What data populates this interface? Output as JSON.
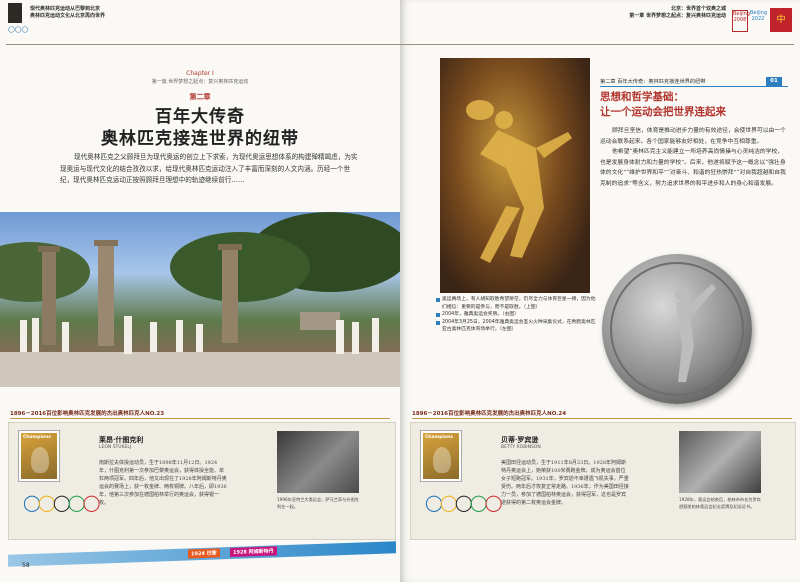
{
  "header": {
    "left_line1": "现代奥林匹克运动从巴黎到北京",
    "left_line2": "奥林匹克运动文化从北京再向世界",
    "right_line1": "北京：世界首个双奥之城",
    "right_line2": "第一章 世界梦想之起点：复兴奥林匹克运动",
    "emblem1": "Beijing 2008",
    "emblem2": "Beijing 2022",
    "emblem3": "中"
  },
  "left_page": {
    "chapter_en": "Chapter I",
    "chapter_sub": "第一篇 世界梦想之起点：复兴奥林匹克运动",
    "chapter_no": "第二章",
    "title_line1": "百年大传奇",
    "title_line2": "奥林匹克接连世界的纽带",
    "intro": "现代奥林匹克之父顾拜旦为现代奥运的创立上下求索，为现代奥运思想体系的构建殚精竭虑，为实现奥运与现代文化的结合孜孜以求，给现代奥林匹克运动注入了丰富而深刻的人文内涵。历经一个世纪，现代奥林匹克运动正按照顾拜旦理想中的轨迹继续前行……",
    "strip": "1896－2016百位影响奥林匹克发展的杰出奥林匹克人NO.23",
    "athlete_name": "莱昂·什图克利",
    "athlete_en": "LEON ŠTUKELJ",
    "athlete_bio": "南斯拉夫体操运动员，生于1898年11月12日。1924年，什图克利第一次参加巴黎奥运会，获得体操全能、单杠两项冠军。四年后，他又出现在了1928年阿姆斯特丹奥运会的赛场上，获一枚金牌、两枚铜牌。八年后，即1936年，他第三次参加在德国柏林举行的奥运会，获得银一枚。",
    "stamp_label": "Champions",
    "photo_caption": "1996年亚特兰大奥运会，萨马兰奇与什图克利在一起。",
    "timeline_mark1": "1924 巴黎",
    "timeline_mark2": "1928 阿姆斯特丹",
    "page_number": "58"
  },
  "right_page": {
    "section_tag": "第二章 百年大传奇：奥林匹克接连世界的纽带",
    "section_num": "01",
    "section_title1": "思想和哲学基础：",
    "section_title2": "让一个运动会把世界连起来",
    "body_p1": "顾拜旦坚信，体育是推动进步力量的有效途径，会使世界可以由一个运动会联系起来。各个国家能够友好相处，在竞争中互相尊重。",
    "body_p2": "他希望“奥林匹克主义能建立一所培养高尚情操与心灵纯洁的学校，也是发展身体耐力和力量的学校”。后来，他遂将赋予这一概念以“强壮身体的文化”“维护世界和平”“对奋斗、和谐的狂热崇拜”“对自我超越和自我克制的追求”等含义，努力追求世界的和平进步和人的身心和谐发展。",
    "cap1": "奥运赛场上，有人胡知取胜希望渺茫，仍尽全力与体育巨星一搏，因为他们相信：重要的是参与，而不是取胜。（上图）",
    "cap2": "2004年，雅典奥运会奖牌。（右图）",
    "cap3": "2004年3月25日，2004年雅典奥运会圣火火种采集仪式，在希腊奥林匹亚古奥林匹克体育场举行。（左图）",
    "strip": "1896－2016百位影响奥林匹克发展的杰出奥林匹克人NO.24",
    "athlete_name": "贝蒂·罗宾逊",
    "athlete_en": "BETTY ROBINSON",
    "athlete_bio": "美国田径运动员，生于1911年8月23日。1928年阿姆斯特丹奥运会上，她荣获100米赛跑金牌，成为奥运会首位女子短跑冠军。1931年，罗宾逊不幸遭遇飞机失事，严重受伤。两年后才恢复正常走路。1936年，作为美国田径接力一员，参加了德国柏林奥运会，获得冠军，这也是罗宾逊获得的第二枚奥运会金牌。",
    "stamp_label": "Champions",
    "photo_caption": "1928年，奥运会结束后，柏林市市长为罗宾逊颁发柏林奥运会纪念奖牌及纪念证书。"
  }
}
